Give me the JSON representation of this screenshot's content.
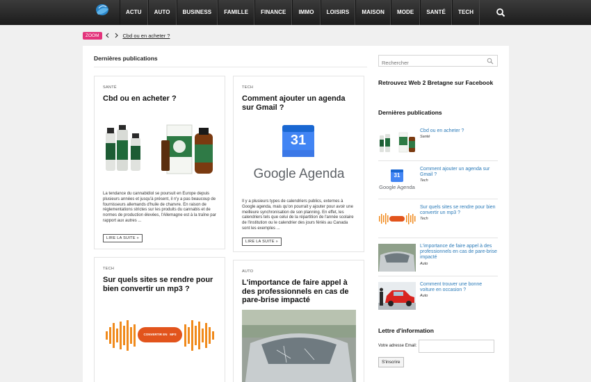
{
  "header": {
    "logo_alt": "Web 2 Bretagne",
    "nav": [
      "ACTU",
      "AUTO",
      "BUSINESS",
      "FAMILLE",
      "FINANCE",
      "IMMO",
      "LOISIRS",
      "MAISON",
      "MODE",
      "SANTÉ",
      "TECH"
    ],
    "search_icon": "search-icon"
  },
  "breadcrumb": {
    "badge": "ZOOM",
    "current": "Cbd ou en acheter ?"
  },
  "main": {
    "section_title": "Dernières publications",
    "cards": [
      {
        "category": "SANTÉ",
        "title": "Cbd ou en acheter ?",
        "excerpt": "La tendance du cannabidiol se poursuit en Europe depuis plusieurs années et jusqu'à présent, il n'y a pas beaucoup de fournisseurs allemands d'huile de chanvre. En raison de réglementations strictes sur les produits du cannabis et de normes de production élevées, l'Allemagne est à la traîne par rapport aux autres ...",
        "read_more": "LIRE LA SUITE »"
      },
      {
        "category": "TECH",
        "title": "Comment ajouter un agenda sur Gmail ?",
        "image_text": "Google Agenda",
        "calendar_number": "31",
        "excerpt": "Il y a plusieurs types de calendriers publics, externes à Google agenda, mais qu'on pourrait y ajouter pour avoir une meilleure synchronisation de son planning. En effet, les calendriers tels que celui de la répartition de l'année scolaire de l'institution ou le calendrier des jours fériés au Canada sont les exemples ...",
        "read_more": "LIRE LA SUITE »"
      },
      {
        "category": "TECH",
        "title": "Sur quels sites se rendre pour bien convertir un mp3 ?",
        "image_text": "CONVERTIR EN   MP3"
      },
      {
        "category": "AUTO",
        "title": "L'importance de faire appel à des professionnels en cas de pare-brise impacté"
      }
    ]
  },
  "sidebar": {
    "search_placeholder": "Rechercher",
    "facebook_title": "Retrouvez Web 2 Bretagne sur Facebook",
    "recent_title": "Dernières publications",
    "recent": [
      {
        "title": "Cbd ou en acheter ?",
        "category": "Santé"
      },
      {
        "title": "Comment ajouter un agenda sur Gmail ?",
        "category": "Tech"
      },
      {
        "title": "Sur quels sites se rendre pour bien convertir un mp3 ?",
        "category": "Tech"
      },
      {
        "title": "L'importance de faire appel à des professionnels en cas de pare-brise impacté",
        "category": "Auto"
      },
      {
        "title": "Comment trouver une bonne voiture en occasion ?",
        "category": "Auto"
      }
    ],
    "newsletter_title": "Lettre d'information",
    "newsletter_label": "Votre adresse Email:",
    "newsletter_button": "S'inscrire",
    "thumb_google_text": "Google Agenda"
  }
}
